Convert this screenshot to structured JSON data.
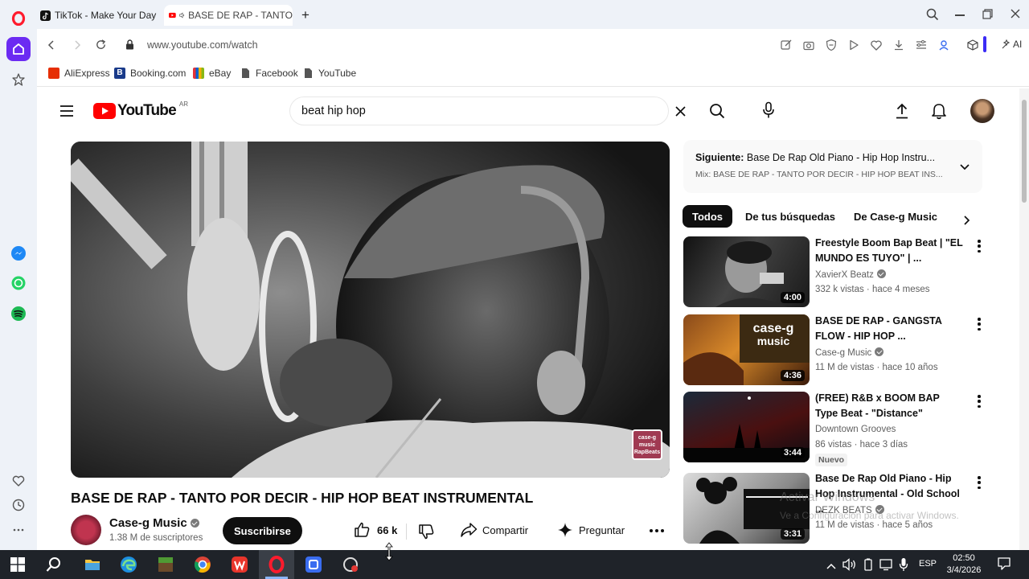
{
  "browser": {
    "tabs": [
      {
        "title": "TikTok - Make Your Day",
        "active": false
      },
      {
        "title": "BASE DE RAP - TANTO",
        "active": true
      }
    ],
    "new_tab_symbol": "+",
    "url": "www.youtube.com/watch",
    "ai_label": "AI",
    "bookmarks": [
      {
        "label": "AliExpress",
        "icon": "aliexpress-icon",
        "color": "#e62e04"
      },
      {
        "label": "Booking.com",
        "icon": "booking-icon",
        "color": "#1a3b8a"
      },
      {
        "label": "eBay",
        "icon": "ebay-icon",
        "color": "#e53238"
      },
      {
        "label": "Facebook",
        "icon": "page-icon",
        "color": "#555555"
      },
      {
        "label": "YouTube",
        "icon": "page-icon",
        "color": "#555555"
      }
    ]
  },
  "youtube": {
    "logo_text": "YouTube",
    "region": "AR",
    "search_value": "beat hip hop",
    "video": {
      "title": "BASE DE RAP - TANTO POR DECIR - HIP HOP BEAT INSTRUMENTAL",
      "watermark_text": "case-g music RapBeats",
      "channel": "Case-g Music",
      "subscribers": "1.38 M de suscriptores",
      "subscribe_label": "Suscribirse",
      "likes": "66 k",
      "share_label": "Compartir",
      "ask_label": "Preguntar"
    },
    "up_next": {
      "label": "Siguiente:",
      "title": "Base De Rap Old Piano - Hip Hop Instru...",
      "mix": "Mix: BASE DE RAP - TANTO POR DECIR - HIP HOP BEAT INS..."
    },
    "chips": [
      "Todos",
      "De tus búsquedas",
      "De Case-g Music"
    ],
    "recommendations": [
      {
        "title": "Freestyle Boom Bap Beat | \"EL MUNDO ES TUYO\" | ...",
        "channel": "XavierX Beatz",
        "verified": true,
        "meta": "332 k vistas · hace 4 meses",
        "duration": "4:00",
        "badge": ""
      },
      {
        "title": "BASE DE RAP -  GANGSTA FLOW  - HIP HOP ...",
        "channel": "Case-g Music",
        "verified": true,
        "meta": "11 M de vistas · hace 10 años",
        "duration": "4:36",
        "badge": ""
      },
      {
        "title": "(FREE) R&B x BOOM BAP Type Beat - \"Distance\"",
        "channel": "Downtown Grooves",
        "verified": false,
        "meta": "86 vistas · hace 3 días",
        "duration": "3:44",
        "badge": "Nuevo"
      },
      {
        "title": "Base De Rap Old Piano - Hip Hop Instrumental - Old School ...",
        "channel": "DEZK BEATS",
        "verified": true,
        "meta": "11 M de vistas · hace 5 años",
        "duration": "3:31",
        "badge": ""
      }
    ],
    "activation_watermark": {
      "line1": "Activar Windows",
      "line2": "Ve a Configuración para activar Windows."
    }
  },
  "taskbar": {
    "language": "ESP",
    "time": "02:50",
    "date": "3/4/2026"
  },
  "colors": {
    "youtube_red": "#ff0000",
    "opera_red": "#ff1b2d",
    "sidebar_bg": "#eef2f8",
    "subscribe_bg": "#0f0f0f",
    "taskbar_bg": "#1f2329"
  }
}
